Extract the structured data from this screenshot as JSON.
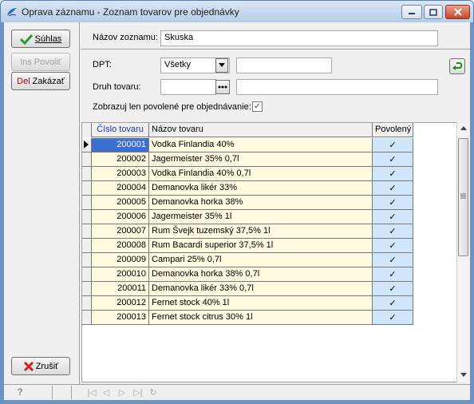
{
  "window": {
    "title": "Oprava záznamu - Zoznam tovarov pre objednávky"
  },
  "buttons": {
    "confirm": {
      "key": "",
      "label": "Súhlas"
    },
    "allow": {
      "key": "Ins",
      "label": "Povoliť"
    },
    "deny": {
      "key": "Del",
      "label": "Zakázať"
    },
    "cancel": {
      "label": "Zrušiť"
    }
  },
  "form": {
    "name_label": "Názov zoznamu:",
    "name_value": "Skuska",
    "dpt_label": "DPT:",
    "dpt_value": "Všetky",
    "dpt_extra": "",
    "goods_type_label": "Druh tovaru:",
    "goods_type_value": "",
    "goods_type_extra": "",
    "only_allowed_label": "Zobrazuj len povolené pre objednávanie:",
    "only_allowed_checked": "✓"
  },
  "grid": {
    "columns": [
      "Číslo tovaru",
      "Názov tovaru",
      "Povolený"
    ],
    "rows": [
      {
        "num": "200001",
        "name": "Vodka Finlandia 40%",
        "ok": "✓"
      },
      {
        "num": "200002",
        "name": "Jagermeister 35% 0,7l",
        "ok": "✓"
      },
      {
        "num": "200003",
        "name": "Vodka Finlandia 40% 0,7l",
        "ok": "✓"
      },
      {
        "num": "200004",
        "name": "Demanovka likér 33%",
        "ok": "✓"
      },
      {
        "num": "200005",
        "name": "Demanovka horka 38%",
        "ok": "✓"
      },
      {
        "num": "200006",
        "name": "Jagermeister 35% 1l",
        "ok": "✓"
      },
      {
        "num": "200007",
        "name": "Rum Švejk tuzemský 37,5% 1l",
        "ok": "✓"
      },
      {
        "num": "200008",
        "name": "Rum Bacardi superior 37,5% 1l",
        "ok": "✓"
      },
      {
        "num": "200009",
        "name": "Campari 25% 0,7l",
        "ok": "✓"
      },
      {
        "num": "200010",
        "name": "Demanovka horka 38% 0,7l",
        "ok": "✓"
      },
      {
        "num": "200011",
        "name": "Demanovka likér 33% 0,7l",
        "ok": "✓"
      },
      {
        "num": "200012",
        "name": "Fernet stock 40% 1l",
        "ok": "✓"
      },
      {
        "num": "200013",
        "name": "Fernet stock citrus 30% 1l",
        "ok": "✓"
      }
    ]
  },
  "status": {
    "help": "?"
  }
}
